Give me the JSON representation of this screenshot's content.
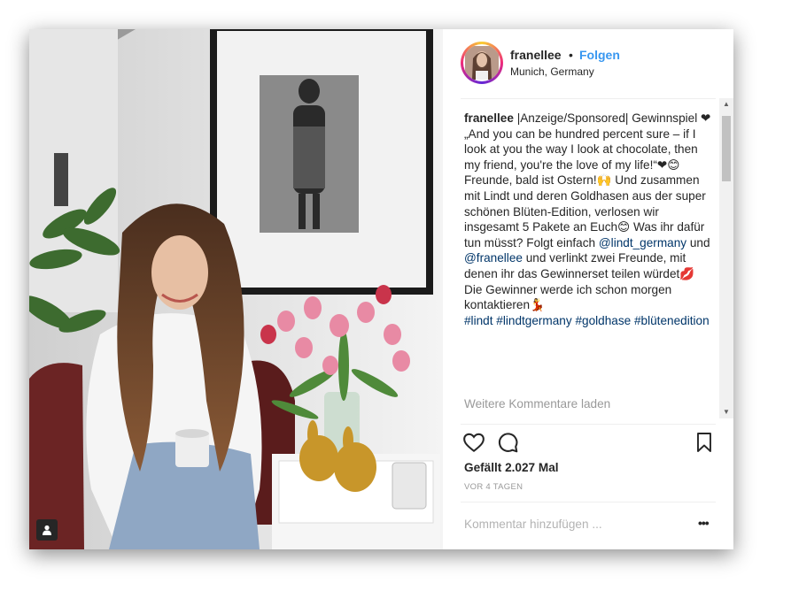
{
  "post": {
    "username": "franellee",
    "separator": "•",
    "follow_label": "Folgen",
    "location": "Munich, Germany"
  },
  "caption": {
    "segments": [
      {
        "type": "user",
        "text": "franellee"
      },
      {
        "type": "text",
        "text": " |Anzeige/Sponsored| Gewinnspiel ❤\n„And you can be hundred percent sure – if I look at you the way I look at chocolate, then my friend, you're the love of my life!“❤😊\nFreunde, bald ist Ostern!🙌 Und zusammen mit Lindt und deren Goldhasen aus der super schönen Blüten-Edition, verlosen wir insgesamt 5 Pakete an Euch😊 Was ihr dafür tun müsst? Folgt einfach "
      },
      {
        "type": "tag",
        "text": "@lindt_germany"
      },
      {
        "type": "text",
        "text": " und "
      },
      {
        "type": "tag",
        "text": "@franellee"
      },
      {
        "type": "text",
        "text": " und verlinkt zwei Freunde, mit denen ihr das Gewinnerset teilen würdet💋 Die Gewinner werde ich schon morgen kontaktieren💃\n"
      },
      {
        "type": "tag",
        "text": "#lindt"
      },
      {
        "type": "text",
        "text": " "
      },
      {
        "type": "tag",
        "text": "#lindtgermany"
      },
      {
        "type": "text",
        "text": " "
      },
      {
        "type": "tag",
        "text": "#goldhase"
      },
      {
        "type": "text",
        "text": " "
      },
      {
        "type": "tag",
        "text": "#blütenedition"
      }
    ]
  },
  "comments": {
    "load_more": "Weitere Kommentare laden"
  },
  "actions": {
    "like_icon": "heart-icon",
    "comment_icon": "speech-bubble-icon",
    "save_icon": "bookmark-icon"
  },
  "stats": {
    "likes": "Gefällt 2.027 Mal",
    "timestamp": "VOR 4 TAGEN"
  },
  "comment_box": {
    "placeholder": "Kommentar hinzufügen ...",
    "options_label": "•••"
  },
  "colors": {
    "link_blue": "#3897f0",
    "tag_navy": "#003569",
    "heart_red": "#ed4956",
    "muted_grey": "#999999"
  }
}
